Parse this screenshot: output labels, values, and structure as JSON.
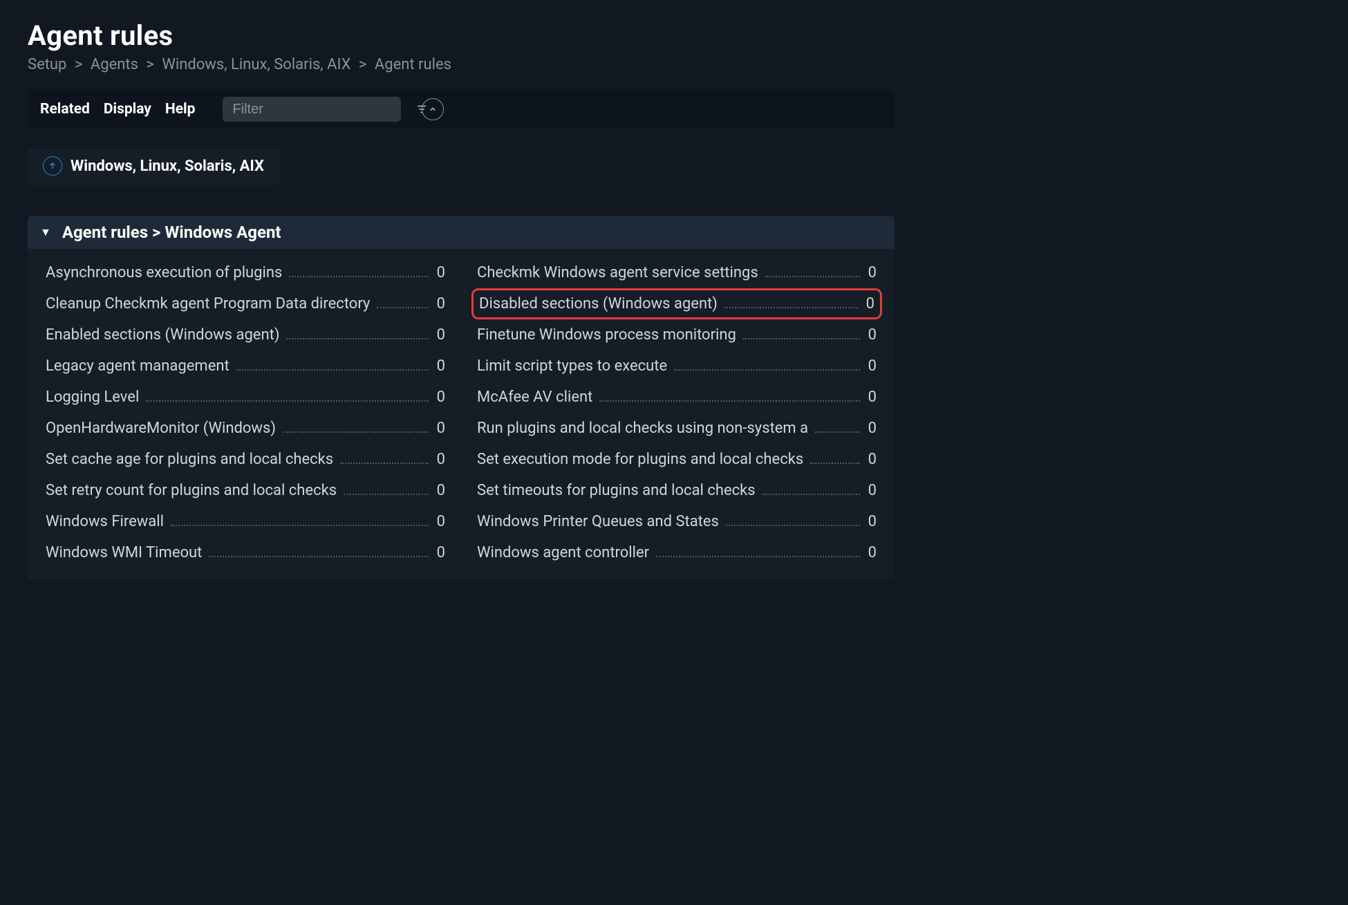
{
  "page": {
    "title": "Agent rules"
  },
  "breadcrumbs": [
    "Setup",
    "Agents",
    "Windows, Linux, Solaris, AIX",
    "Agent rules"
  ],
  "toolbar": {
    "related": "Related",
    "display": "Display",
    "help": "Help",
    "filter_placeholder": "Filter"
  },
  "context_chip": {
    "label": "Windows, Linux, Solaris, AIX"
  },
  "section": {
    "header": "Agent rules  >  Windows Agent",
    "rules_left": [
      {
        "label": "Asynchronous execution of plugins",
        "count": 0
      },
      {
        "label": "Cleanup Checkmk agent Program Data directory",
        "count": 0
      },
      {
        "label": "Enabled sections (Windows agent)",
        "count": 0
      },
      {
        "label": "Legacy agent management",
        "count": 0
      },
      {
        "label": "Logging Level",
        "count": 0
      },
      {
        "label": "OpenHardwareMonitor (Windows)",
        "count": 0
      },
      {
        "label": "Set cache age for plugins and local checks",
        "count": 0
      },
      {
        "label": "Set retry count for plugins and local checks",
        "count": 0
      },
      {
        "label": "Windows Firewall",
        "count": 0
      },
      {
        "label": "Windows WMI Timeout",
        "count": 0
      }
    ],
    "rules_right": [
      {
        "label": "Checkmk Windows agent service settings",
        "count": 0
      },
      {
        "label": "Disabled sections (Windows agent)",
        "count": 0,
        "highlight": true
      },
      {
        "label": "Finetune Windows process monitoring",
        "count": 0
      },
      {
        "label": "Limit script types to execute",
        "count": 0
      },
      {
        "label": "McAfee AV client",
        "count": 0
      },
      {
        "label": "Run plugins and local checks using non-system a",
        "count": 0
      },
      {
        "label": "Set execution mode for plugins and local checks",
        "count": 0
      },
      {
        "label": "Set timeouts for plugins and local checks",
        "count": 0
      },
      {
        "label": "Windows Printer Queues and States",
        "count": 0
      },
      {
        "label": "Windows agent controller",
        "count": 0
      }
    ]
  }
}
